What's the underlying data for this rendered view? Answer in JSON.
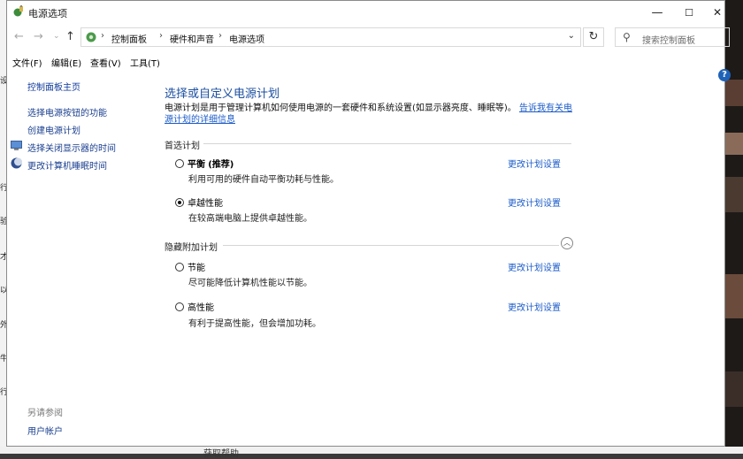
{
  "window": {
    "title": "电源选项",
    "controls": {
      "minimize": "—",
      "maximize": "☐",
      "close": "✕"
    }
  },
  "address_bar": {
    "breadcrumbs": [
      "控制面板",
      "硬件和声音",
      "电源选项"
    ],
    "separator": "›",
    "search_placeholder": "搜索控制面板"
  },
  "menu": [
    "文件(F)",
    "编辑(E)",
    "查看(V)",
    "工具(T)"
  ],
  "sidebar": {
    "home": "控制面板主页",
    "links": [
      "选择电源按钮的功能",
      "创建电源计划",
      "选择关闭显示器的时间",
      "更改计算机睡眠时间"
    ],
    "see_also_heading": "另请参阅",
    "see_also": [
      "用户帐户"
    ]
  },
  "main": {
    "title": "选择或自定义电源计划",
    "description": "电源计划是用于管理计算机如何使用电源的一套硬件和系统设置(如显示器亮度、睡眠等)。",
    "description_link": "告诉我有关电源计划的详细信息",
    "preferred_heading": "首选计划",
    "hidden_heading": "隐藏附加计划",
    "change_label": "更改计划设置",
    "preferred_plans": [
      {
        "name": "平衡",
        "suffix": "(推荐)",
        "desc": "利用可用的硬件自动平衡功耗与性能。",
        "selected": false
      },
      {
        "name": "卓越性能",
        "suffix": "",
        "desc": "在较高端电脑上提供卓越性能。",
        "selected": true
      }
    ],
    "hidden_plans": [
      {
        "name": "节能",
        "suffix": "",
        "desc": "尽可能降低计算机性能以节能。",
        "selected": false
      },
      {
        "name": "高性能",
        "suffix": "",
        "desc": "有利于提高性能，但会增加功耗。",
        "selected": false
      }
    ]
  },
  "background": {
    "bottom_text": "获取帮助"
  }
}
